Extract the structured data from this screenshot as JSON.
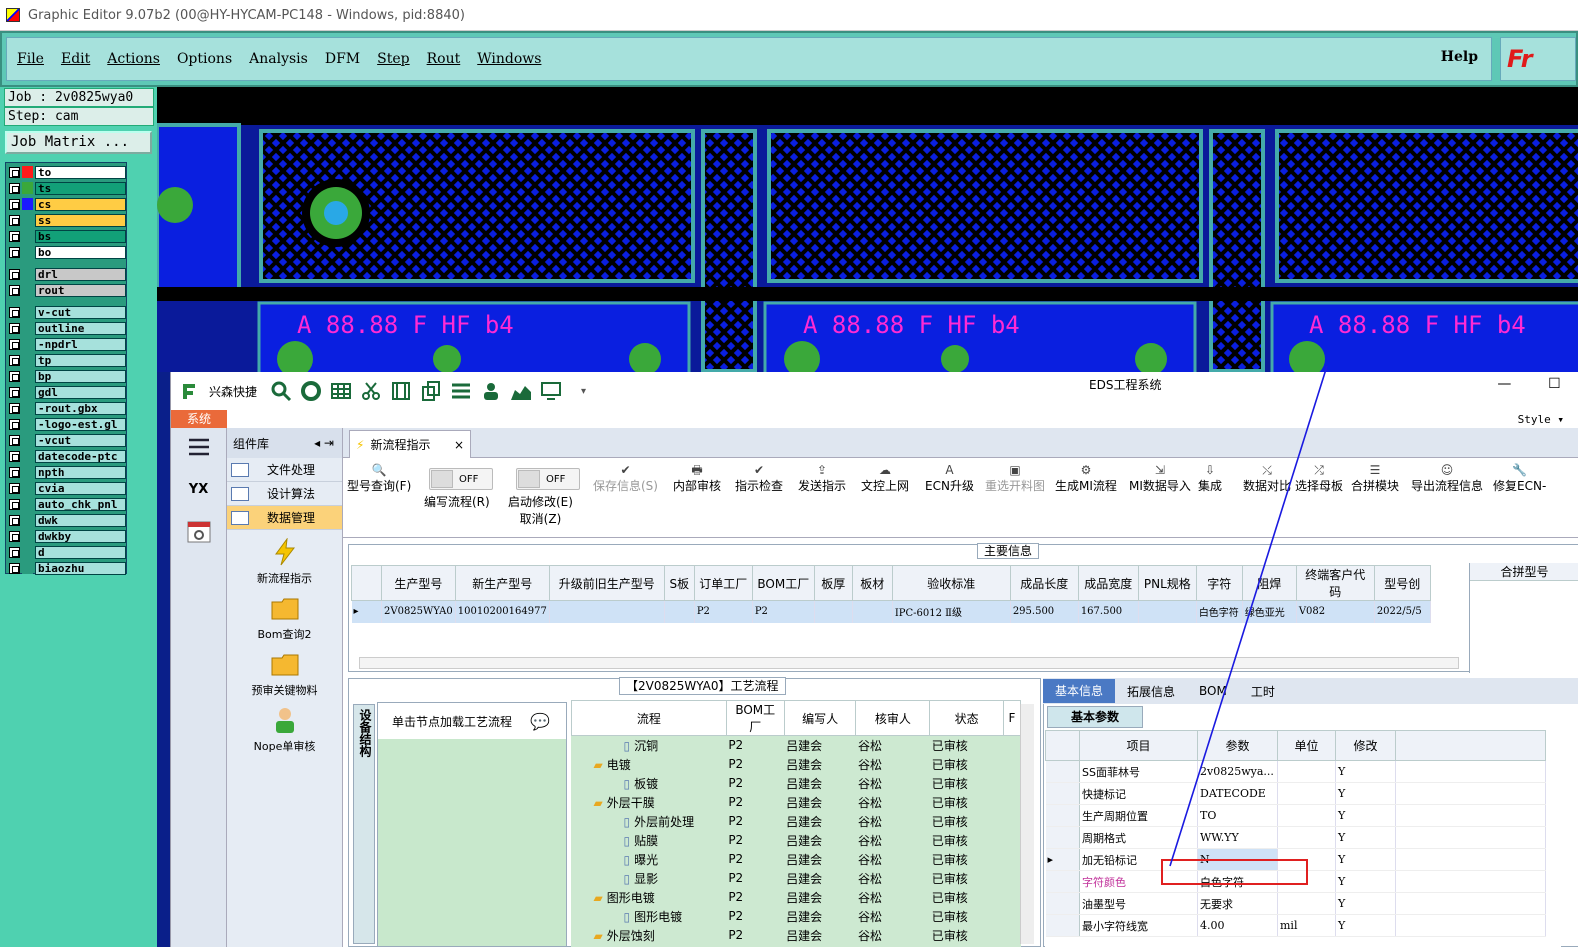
{
  "window": {
    "title": "Graphic Editor 9.07b2 (00@HY-HYCAM-PC148 - Windows, pid:8840)"
  },
  "menu": {
    "items": [
      "File",
      "Edit",
      "Actions",
      "Options",
      "Analysis",
      "DFM",
      "Step",
      "Rout",
      "Windows"
    ],
    "help": "Help",
    "logo": "Fr"
  },
  "job": {
    "job": "Job : 2v0825wya0",
    "step": "Step: cam",
    "matrix": "Job Matrix ..."
  },
  "layers": [
    {
      "name": "to",
      "color": "#ff1a1a",
      "bg": "#ffffff"
    },
    {
      "name": "ts",
      "color": "#3aa83a",
      "bg": "#12a078"
    },
    {
      "name": "cs",
      "color": "#1a1aff",
      "bg": "#ffcc44"
    },
    {
      "name": "ss",
      "color": "#2a9b7e",
      "bg": "#ffcc44"
    },
    {
      "name": "bs",
      "color": "#2a9b7e",
      "bg": "#12a078"
    },
    {
      "name": "bo",
      "color": "#2a9b7e",
      "bg": "#ffffff"
    },
    {
      "name": "drl",
      "color": "#2a9b7e",
      "bg": "#c8c8c8"
    },
    {
      "name": "rout",
      "color": "#2a9b7e",
      "bg": "#c8c8c8"
    },
    {
      "name": "v-cut",
      "color": "#2a9b7e",
      "bg": "#a6e1dc"
    },
    {
      "name": "outline",
      "color": "#2a9b7e",
      "bg": "#a6e1dc"
    },
    {
      "name": "-npdrl",
      "color": "#2a9b7e",
      "bg": "#a6e1dc"
    },
    {
      "name": "tp",
      "color": "#2a9b7e",
      "bg": "#a6e1dc"
    },
    {
      "name": "bp",
      "color": "#2a9b7e",
      "bg": "#a6e1dc"
    },
    {
      "name": "gdl",
      "color": "#2a9b7e",
      "bg": "#a6e1dc"
    },
    {
      "name": "-rout.gbx",
      "color": "#2a9b7e",
      "bg": "#a6e1dc"
    },
    {
      "name": "-logo-est.gl",
      "color": "#2a9b7e",
      "bg": "#a6e1dc"
    },
    {
      "name": "-vcut",
      "color": "#2a9b7e",
      "bg": "#a6e1dc"
    },
    {
      "name": "datecode-ptc",
      "color": "#2a9b7e",
      "bg": "#a6e1dc"
    },
    {
      "name": "npth",
      "color": "#2a9b7e",
      "bg": "#a6e1dc"
    },
    {
      "name": "cvia",
      "color": "#2a9b7e",
      "bg": "#a6e1dc"
    },
    {
      "name": "auto_chk_pnl",
      "color": "#2a9b7e",
      "bg": "#a6e1dc"
    },
    {
      "name": "dwk",
      "color": "#2a9b7e",
      "bg": "#a6e1dc"
    },
    {
      "name": "dwkby",
      "color": "#2a9b7e",
      "bg": "#a6e1dc"
    },
    {
      "name": "d",
      "color": "#2a9b7e",
      "bg": "#a6e1dc"
    },
    {
      "name": "biaozhu",
      "color": "#2a9b7e",
      "bg": "#a6e1dc"
    }
  ],
  "pcb": {
    "label": "A 88.88 F HF b4"
  },
  "eds": {
    "app": "兴森快捷",
    "title": "EDS工程系统",
    "style": "Style",
    "system": "系统",
    "component_lib": "组件库",
    "comp_items": [
      "文件处理",
      "设计算法",
      "数据管理"
    ],
    "tools": [
      "新流程指示",
      "Bom查询2",
      "预审关键物料",
      "Nope单审核"
    ],
    "tab": "新流程指示",
    "ribbon": [
      {
        "label": "型号查询(F)",
        "icon": "search-icon"
      },
      {
        "label": "编写流程(R)",
        "icon": "toggle"
      },
      {
        "label": "启动修改(E)",
        "sub": "取消(Z)",
        "icon": "toggle"
      },
      {
        "label": "保存信息(S)",
        "icon": "check-icon",
        "disabled": true
      },
      {
        "label": "内部审核",
        "icon": "print-icon"
      },
      {
        "label": "指示检查",
        "icon": "check-icon"
      },
      {
        "label": "发送指示",
        "icon": "upload-icon"
      },
      {
        "label": "文控上网",
        "icon": "cloud-icon"
      },
      {
        "label": "ECN升级",
        "icon": "a-icon"
      },
      {
        "label": "重选开料图",
        "icon": "image-icon",
        "disabled": true
      },
      {
        "label": "生成MI流程",
        "icon": "gear-icon"
      },
      {
        "label": "MI数据导入",
        "icon": "import-icon"
      },
      {
        "label": "集成",
        "icon": "download-icon"
      },
      {
        "label": "数据对比",
        "icon": "compare-icon"
      },
      {
        "label": "选择母板",
        "icon": "shuffle-icon"
      },
      {
        "label": "合拼模块",
        "icon": "list-icon"
      },
      {
        "label": "导出流程信息",
        "icon": "smile-icon"
      },
      {
        "label": "修复ECN-",
        "icon": "wrench-icon"
      }
    ],
    "toggle_off": "OFF",
    "main_info": {
      "header": "主要信息",
      "columns": [
        "生产型号",
        "新生产型号",
        "升级前旧生产型号",
        "S板",
        "订单工厂",
        "BOM工厂",
        "板厚",
        "板材",
        "验收标准",
        "成品长度",
        "成品宽度",
        "PNL规格",
        "字符",
        "阻焊",
        "终端客户代码",
        "型号创"
      ],
      "row": [
        "2V0825WYA0",
        "10010200164977",
        "",
        "",
        "P2",
        "P2",
        "",
        "",
        "IPC-6012 Ⅱ级",
        "295.500",
        "167.500",
        "",
        "白色字符",
        "绿色亚光",
        "V082",
        "2022/5/5"
      ],
      "merge_label": "合拼型号"
    },
    "flow": {
      "header": "【2V0825WYA0】工艺流程",
      "device_tab": "设备结构",
      "node_hint": "单击节点加载工艺流程",
      "columns": [
        "流程",
        "BOM工厂",
        "编写人",
        "核审人",
        "状态",
        "F"
      ],
      "rows": [
        {
          "name": "沉铜",
          "level": 2,
          "folder": false
        },
        {
          "name": "电镀",
          "level": 1,
          "folder": true
        },
        {
          "name": "板镀",
          "level": 2,
          "folder": false
        },
        {
          "name": "外层干膜",
          "level": 1,
          "folder": true
        },
        {
          "name": "外层前处理",
          "level": 2,
          "folder": false
        },
        {
          "name": "贴膜",
          "level": 2,
          "folder": false
        },
        {
          "name": "曝光",
          "level": 2,
          "folder": false
        },
        {
          "name": "显影",
          "level": 2,
          "folder": false
        },
        {
          "name": "图形电镀",
          "level": 1,
          "folder": true
        },
        {
          "name": "图形电镀",
          "level": 2,
          "folder": false
        },
        {
          "name": "外层蚀刻",
          "level": 1,
          "folder": true
        }
      ],
      "bom": "P2",
      "author": "吕建会",
      "reviewer": "谷松",
      "status": "已审核"
    },
    "right": {
      "tabs": [
        "基本信息",
        "拓展信息",
        "BOM",
        "工时"
      ],
      "basic_params": "基本参数",
      "columns": [
        "项目",
        "参数",
        "单位",
        "修改"
      ],
      "rows": [
        {
          "item": "SS面菲林号",
          "value": "2v0825wya...",
          "unit": "",
          "mod": "Y"
        },
        {
          "item": "快捷标记",
          "value": "DATECODE",
          "unit": "",
          "mod": "Y"
        },
        {
          "item": "生产周期位置",
          "value": "TO",
          "unit": "",
          "mod": "Y"
        },
        {
          "item": "周期格式",
          "value": "WW.YY",
          "unit": "",
          "mod": "Y"
        },
        {
          "item": "加无铅标记",
          "value": "N",
          "unit": "",
          "mod": "Y"
        },
        {
          "item": "字符颜色",
          "value": "白色字符",
          "unit": "",
          "mod": "Y"
        },
        {
          "item": "油墨型号",
          "value": "无要求",
          "unit": "",
          "mod": "Y"
        },
        {
          "item": "最小字符线宽",
          "value": "4.00",
          "unit": "mil",
          "mod": "Y"
        }
      ]
    }
  }
}
